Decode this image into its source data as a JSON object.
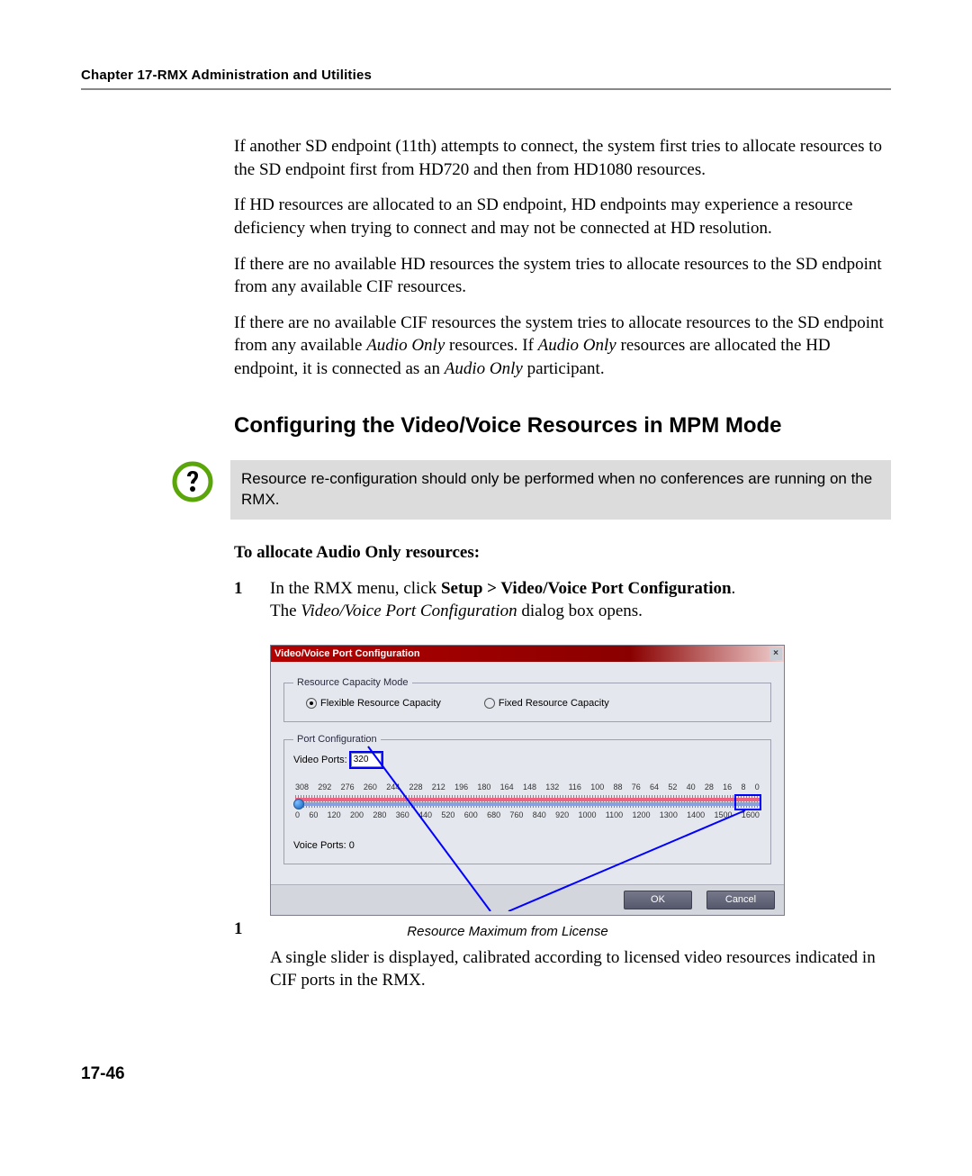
{
  "header": {
    "running": "Chapter 17-RMX Administration and Utilities"
  },
  "paragraphs": {
    "p1_a": "If another SD endpoint (11th) attempts to connect, the system first tries to allocate resources to the SD endpoint first from HD720 and then from HD1080 resources.",
    "p2_a": "If HD resources are allocated to an SD endpoint, HD endpoints may experience a resource deficiency when trying to connect and may not be connected at HD resolution.",
    "p3_a": "If there are no available HD resources the system tries to allocate resources to the SD endpoint from any available CIF resources.",
    "p4_a": "If there are no available CIF resources the system tries to allocate resources to the SD endpoint from any available ",
    "p4_b": "Audio Only",
    "p4_c": " resources. If ",
    "p4_d": "Audio Only",
    "p4_e": " resources are allocated the HD endpoint, it is connected as an ",
    "p4_f": "Audio Only",
    "p4_g": " participant."
  },
  "section_heading": "Configuring the Video/Voice Resources in MPM Mode",
  "note": "Resource re-configuration should only be performed when no conferences are running on the RMX.",
  "procedure": {
    "intro": "To allocate Audio Only resources:",
    "step1_num": "1",
    "step1_a": "In the RMX menu, click ",
    "step1_b": "Setup > Video/Voice Port Configuration",
    "step1_c": ".",
    "step1_d": "The ",
    "step1_e": "Video/Voice Port Configuration",
    "step1_f": " dialog box opens."
  },
  "dialog": {
    "title": "Video/Voice Port Configuration",
    "fs1_legend": "Resource Capacity Mode",
    "radio_flexible": "Flexible Resource Capacity",
    "radio_fixed": "Fixed Resource Capacity",
    "fs2_legend": "Port Configuration",
    "video_ports_label": "Video Ports:",
    "video_ports_value": "320",
    "top_ticks": [
      "308",
      "292",
      "276",
      "260",
      "244",
      "228",
      "212",
      "196",
      "180",
      "164",
      "148",
      "132",
      "116",
      "100",
      "88",
      "76",
      "64",
      "52",
      "40",
      "28",
      "16",
      "8",
      "0"
    ],
    "bot_ticks": [
      "0",
      "60",
      "120",
      "200",
      "280",
      "360",
      "440",
      "520",
      "600",
      "680",
      "760",
      "840",
      "920",
      "1000",
      "1100",
      "1200",
      "1300",
      "1400",
      "1500",
      "1600"
    ],
    "voice_ports": "Voice Ports: 0",
    "ok": "OK",
    "cancel": "Cancel"
  },
  "figure": {
    "step_marker": "1",
    "caption": "Resource Maximum from License"
  },
  "after_figure": "A single slider is displayed, calibrated according to licensed video resources indicated in CIF ports in the RMX.",
  "page_number": "17-46"
}
